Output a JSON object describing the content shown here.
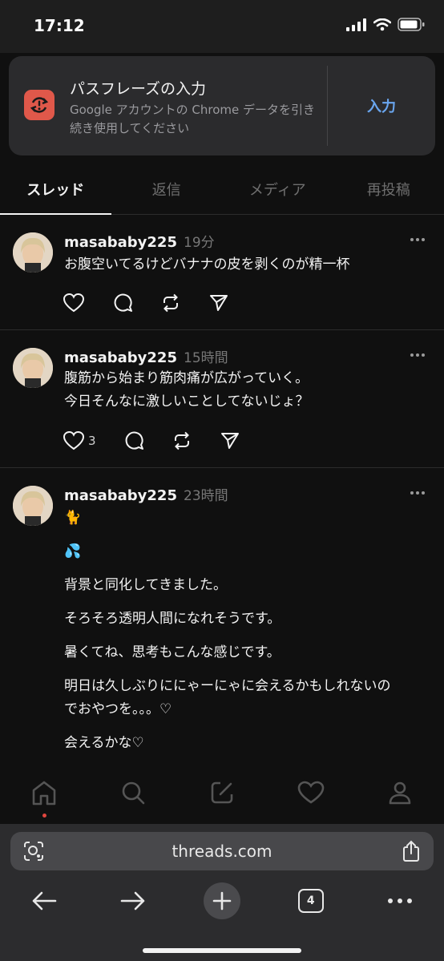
{
  "status_bar": {
    "time": "17:12"
  },
  "passphrase_banner": {
    "title": "パスフレーズの入力",
    "description": "Google アカウントの Chrome データを引き続き使用してください",
    "action_label": "入力",
    "icon": "sync-error-icon",
    "accent_color": "#e0584a"
  },
  "tabs": [
    {
      "label": "スレッド",
      "active": true
    },
    {
      "label": "返信",
      "active": false
    },
    {
      "label": "メディア",
      "active": false
    },
    {
      "label": "再投稿",
      "active": false
    }
  ],
  "posts": [
    {
      "username": "masababy225",
      "time": "19分",
      "lines": [
        "お腹空いてるけどバナナの皮を剥くのが精一杯"
      ],
      "like_count": ""
    },
    {
      "username": "masababy225",
      "time": "15時間",
      "lines": [
        "腹筋から始まり筋肉痛が広がっていく。",
        "今日そんなに激しいことしてないじょ？"
      ],
      "like_count": "3"
    },
    {
      "username": "masababy225",
      "time": "23時間",
      "lines": [
        "🐈",
        "💦",
        "背景と同化してきました。",
        "そろそろ透明人間になれそうです。",
        "暑くてね、思考もこんな感じです。",
        "明日は久しぶりににゃーにゃに会えるかもしれないの",
        "でおやつを。。。♡",
        "会えるかな♡"
      ],
      "like_count": ""
    }
  ],
  "browser": {
    "url": "threads.com",
    "tab_count": "4"
  },
  "colors": {
    "background": "#101010",
    "link_accent": "#6aa6ef",
    "notification_dot": "#e0463f"
  }
}
